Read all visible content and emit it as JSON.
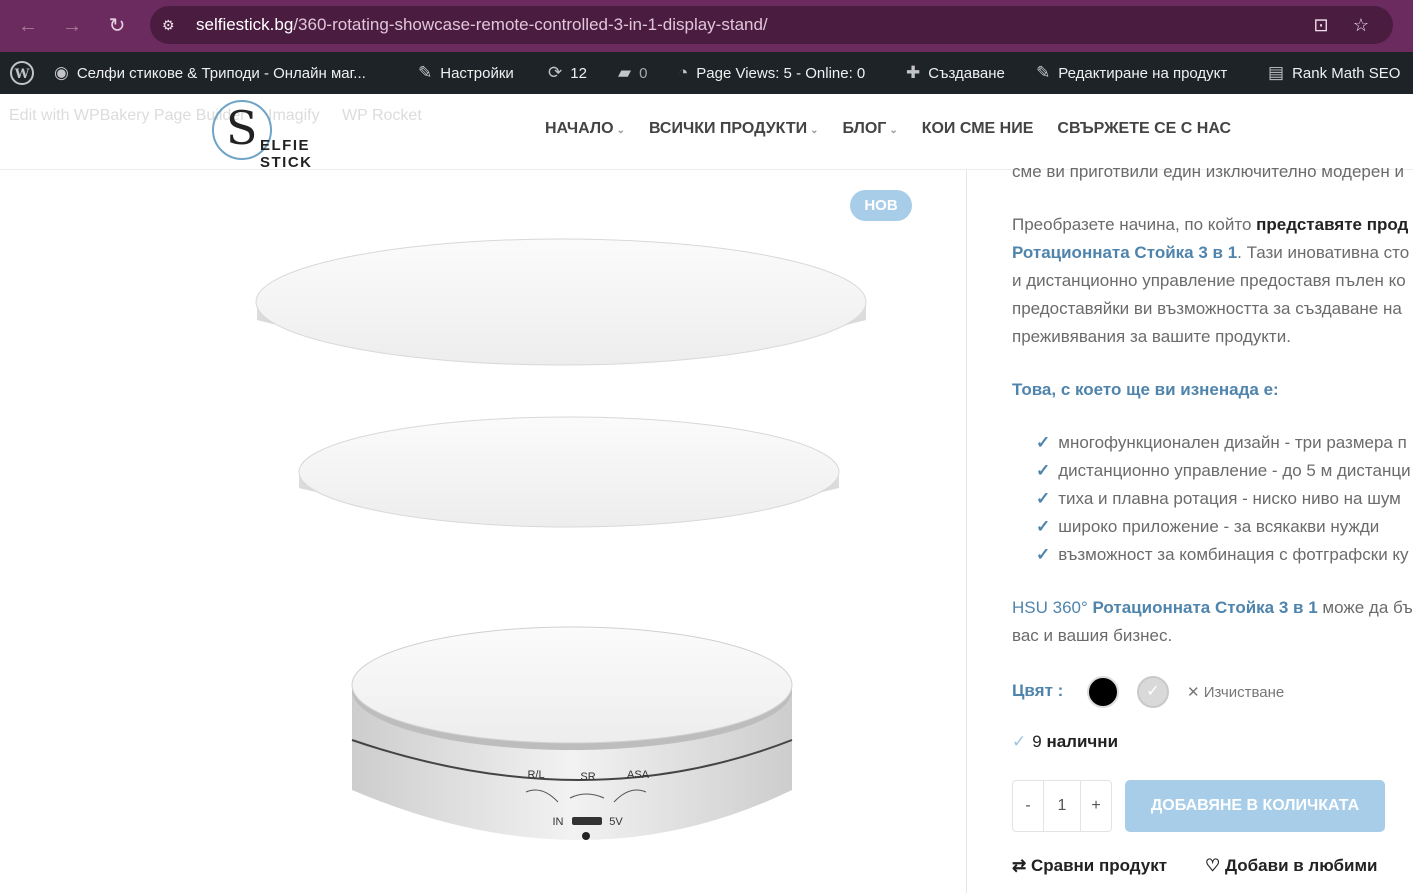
{
  "browser": {
    "url_host": "selfiestick.bg",
    "url_path": "/360-rotating-showcase-remote-controlled-3-in-1-display-stand/"
  },
  "admin_bar": {
    "site_name": "Селфи стикове & Триподи - Онлайн маг...",
    "customize": "Настройки",
    "updates": "12",
    "comments": "0",
    "page_views": "Page Views: 5 - Online: 0",
    "new": "Създаване",
    "edit_product": "Редактиране на продукт",
    "rank_math": "Rank Math SEO"
  },
  "wp_links": [
    "Edit with WPBakery Page Builder",
    "Imagify",
    "WP Rocket"
  ],
  "logo": {
    "text": "ELFIE STICK"
  },
  "nav": {
    "home": "НАЧАЛО",
    "all_products": "ВСИЧКИ ПРОДУКТИ",
    "blog": "БЛОГ",
    "about": "КОИ СМЕ НИЕ",
    "contact": "СВЪРЖЕТЕ СЕ С НАС"
  },
  "badge": "НОВ",
  "description": {
    "line0": "сме ви приготвили един изключително модерен и",
    "p1_a": "Преобразете начина, по който ",
    "p1_b": "представяте прод",
    "p1_line2_a": "Ротационната Стойка 3 в 1",
    "p1_line2_b": ". Тази иновативна сто",
    "p1_line3": "и дистанционно управление предоставя пълен ко",
    "p1_line4": "предоставяйки ви възможността за създаване на",
    "p1_line5": "преживявания за вашите продукти.",
    "surprise": "Това, с което ще ви изненада е:",
    "features": [
      "многофункционален дизайн - три размера п",
      "дистанционно управление - до 5 м дистанци",
      "тиха и плавна ротация - ниско ниво на шум",
      "широко приложение - за всякакви нужди",
      "възможност за комбинация с фотграфски ку"
    ],
    "p2_a": "HSU 360° ",
    "p2_b": "Ротационната Стойка 3 в 1",
    "p2_c": " може да бъ",
    "p2_line2": "вас и вашия бизнес."
  },
  "color": {
    "label": "Цвят :",
    "clear": "Изчистване",
    "swatch_colors": [
      "#000000",
      "#d9d9d9"
    ]
  },
  "stock": {
    "count": "9",
    "label": "налични"
  },
  "quantity": {
    "minus": "-",
    "value": "1",
    "plus": "+"
  },
  "add_to_cart": "ДОБАВЯНЕ В КОЛИЧКАТА",
  "compare": "Сравни продукт",
  "wishlist": "Добави в любими",
  "stand_labels": {
    "rl": "R/L",
    "sr": "SR",
    "asa": "ASA",
    "in": "IN",
    "5v": "5V"
  }
}
